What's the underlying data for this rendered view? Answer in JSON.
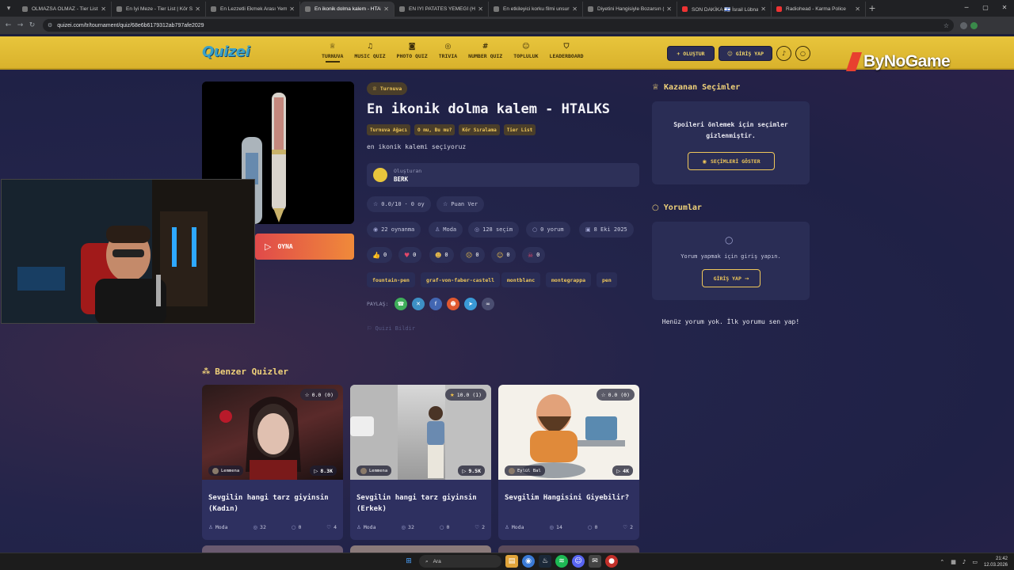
{
  "browser": {
    "tabs": [
      {
        "title": "OLMAZSA OLMAZ - Tier List |",
        "active": false
      },
      {
        "title": "En İyi Meze - Tier List | Kör Sıra",
        "active": false
      },
      {
        "title": "En Lezzetli Ekmek Arası Yemeği",
        "active": false
      },
      {
        "title": "En ikonik dolma kalem - HTALK",
        "active": true
      },
      {
        "title": "EN İYİ PATATES YEMEĞİ (HTALK",
        "active": false
      },
      {
        "title": "En etkileyici korku filmi unsuru",
        "active": false
      },
      {
        "title": "Diyetini Hangisiyle Bozarsın (H",
        "active": false
      },
      {
        "title": "SON DAKİKA 🇮🇱 İsrail Lübnan'ı",
        "active": false
      },
      {
        "title": "Radiohead - Karma Police",
        "active": false
      }
    ],
    "url": "quizei.com/tr/tournament/quiz/68e6b6179312ab797afe2029"
  },
  "header": {
    "logo": "Quizei",
    "nav": [
      {
        "label": "TURNUVA",
        "icon": "trophy-icon",
        "glyph": "♕",
        "active": true
      },
      {
        "label": "MUSIC QUIZ",
        "icon": "music-icon",
        "glyph": "♫",
        "active": false
      },
      {
        "label": "PHOTO QUIZ",
        "icon": "camera-icon",
        "glyph": "◙",
        "active": false
      },
      {
        "label": "TRIVIA",
        "icon": "chat-icon",
        "glyph": "◎",
        "active": false
      },
      {
        "label": "NUMBER QUIZ",
        "icon": "hash-icon",
        "glyph": "#",
        "active": false
      },
      {
        "label": "TOPLULUK",
        "icon": "users-icon",
        "glyph": "☺",
        "active": false
      },
      {
        "label": "LEADERBOARD",
        "icon": "medal-icon",
        "glyph": "⛉",
        "active": false
      }
    ],
    "create_label": "+ OLUŞTUR",
    "login_label": "GİRİŞ YAP"
  },
  "overlay_brand": "ByNoGame",
  "quiz": {
    "type_badge": "Turnuva",
    "title": "En ikonik dolma kalem - HTALKS",
    "categories": [
      "Turnuva Ağacı",
      "O mu, Bu mu?",
      "Kör Sıralama",
      "Tier List"
    ],
    "description": "en ikonik kalemi seçiyoruz",
    "creator_label": "Oluşturan",
    "creator_name": "BERK",
    "rating": "0.0/10",
    "votes": "0 oy",
    "rate_label": "Puan Ver",
    "plays": "22 oynanma",
    "category": "Moda",
    "choices": "128 seçim",
    "comments": "0 yorum",
    "date": "8 Eki 2025",
    "reactions": [
      {
        "emoji": "👍",
        "count": "0",
        "name": "thumbs-up"
      },
      {
        "emoji": "♥",
        "count": "0",
        "name": "heart"
      },
      {
        "emoji": "☻",
        "count": "0",
        "name": "laugh"
      },
      {
        "emoji": "☹",
        "count": "0",
        "name": "wow"
      },
      {
        "emoji": "☺",
        "count": "0",
        "name": "sad"
      },
      {
        "emoji": "☠",
        "count": "0",
        "name": "angry"
      }
    ],
    "tags": [
      "fountain-pen",
      "graf-von-faber-castell",
      "montblanc",
      "montegrappa",
      "pen"
    ],
    "share_label": "PAYLAŞ:",
    "report_label": "Quizi Bildir",
    "play_label": "OYNA"
  },
  "sidebar": {
    "winners_title": "Kazanan Seçimler",
    "spoiler_text": "Spoileri önlemek için seçimler gizlenmiştir.",
    "show_label": "SEÇİMLERİ GÖSTER",
    "comments_title": "Yorumlar",
    "login_prompt": "Yorum yapmak için giriş yapın.",
    "login_label": "GİRİŞ YAP",
    "no_comments": "Henüz yorum yok. İlk yorumu sen yap!"
  },
  "similar": {
    "title": "Benzer Quizler",
    "cards": [
      {
        "title": "Sevgilin hangi tarz giyinsin (Kadın)",
        "rating": "0.0 (0)",
        "author": "Lemmena",
        "plays": "8.3K",
        "category": "Moda",
        "choices": "32",
        "comments": "0",
        "likes": "4"
      },
      {
        "title": "Sevgilin hangi tarz giyinsin (Erkek)",
        "rating": "10.0 (1)",
        "author": "Lemmena",
        "plays": "9.5K",
        "category": "Moda",
        "choices": "32",
        "comments": "0",
        "likes": "2"
      },
      {
        "title": "Sevgilim Hangisini Giyebilir?",
        "rating": "0.0 (0)",
        "author": "Eylül Bal",
        "plays": "4K",
        "category": "Moda",
        "choices": "14",
        "comments": "0",
        "likes": "2"
      }
    ]
  },
  "taskbar": {
    "search_placeholder": "Ara",
    "time": "21:42",
    "date": "12.03.2026"
  }
}
